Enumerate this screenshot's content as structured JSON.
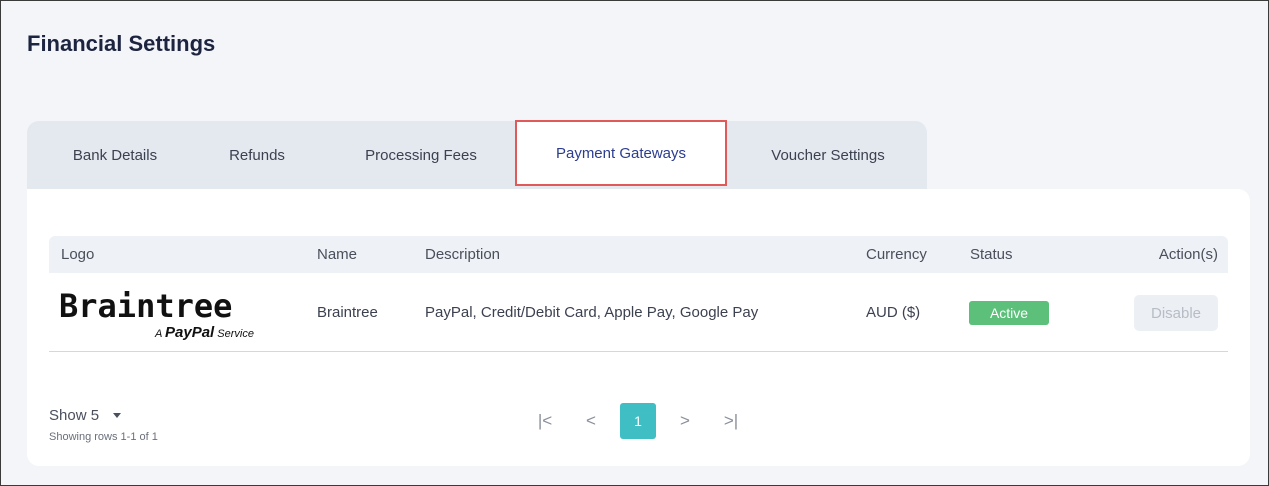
{
  "page": {
    "title": "Financial Settings"
  },
  "tabs": [
    {
      "label": "Bank Details"
    },
    {
      "label": "Refunds"
    },
    {
      "label": "Processing Fees"
    },
    {
      "label": "Payment Gateways",
      "active": true
    },
    {
      "label": "Voucher Settings"
    }
  ],
  "table": {
    "headers": {
      "logo": "Logo",
      "name": "Name",
      "description": "Description",
      "currency": "Currency",
      "status": "Status",
      "actions": "Action(s)"
    },
    "rows": [
      {
        "logo": {
          "main": "Braintree",
          "sub_prefix": "A",
          "sub_brand": "PayPal",
          "sub_suffix": "Service"
        },
        "name": "Braintree",
        "description": "PayPal, Credit/Debit Card, Apple Pay, Google Pay",
        "currency": "AUD ($)",
        "status": "Active",
        "action": "Disable"
      }
    ]
  },
  "footer": {
    "show_label": "Show 5",
    "rows_info": "Showing rows 1-1 of 1",
    "pagination": {
      "first": "|<",
      "prev": "<",
      "current": "1",
      "next": ">",
      "last": ">|"
    }
  },
  "colors": {
    "active_tab_outline": "#e05a5a",
    "status_active": "#5cc07a",
    "pager_current": "#3fbfc4"
  }
}
